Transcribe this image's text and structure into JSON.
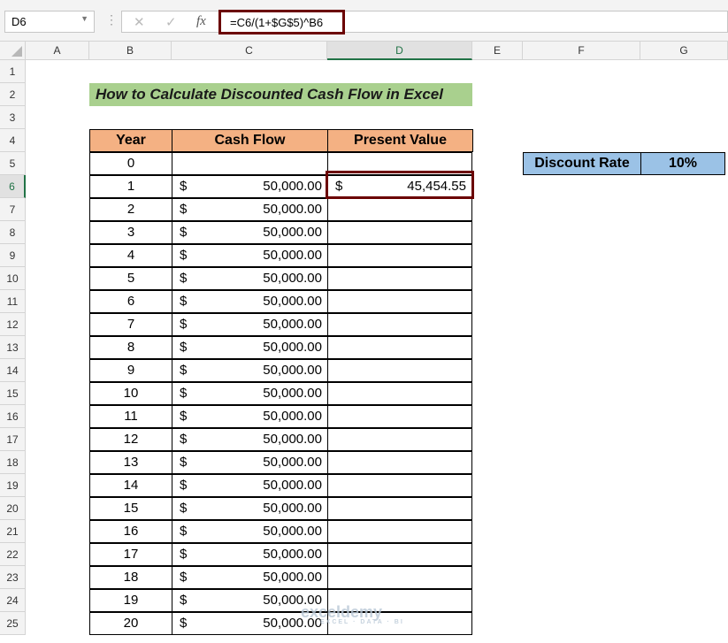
{
  "formula_bar": {
    "name_box": "D6",
    "formula": "=C6/(1+$G$5)^B6",
    "cancel_icon": "✕",
    "enter_icon": "✓",
    "fx_icon": "fx"
  },
  "columns": [
    "A",
    "B",
    "C",
    "D",
    "E",
    "F",
    "G"
  ],
  "selected_column": "D",
  "selected_row": 6,
  "title": "How to Calculate Discounted Cash Flow in Excel",
  "table": {
    "headers": [
      "Year",
      "Cash Flow",
      "Present Value"
    ],
    "rows": [
      {
        "year": "0",
        "currency": "",
        "cash_flow": "",
        "pv_currency": "",
        "pv": ""
      },
      {
        "year": "1",
        "currency": "$",
        "cash_flow": "50,000.00",
        "pv_currency": "$",
        "pv": "45,454.55"
      },
      {
        "year": "2",
        "currency": "$",
        "cash_flow": "50,000.00"
      },
      {
        "year": "3",
        "currency": "$",
        "cash_flow": "50,000.00"
      },
      {
        "year": "4",
        "currency": "$",
        "cash_flow": "50,000.00"
      },
      {
        "year": "5",
        "currency": "$",
        "cash_flow": "50,000.00"
      },
      {
        "year": "6",
        "currency": "$",
        "cash_flow": "50,000.00"
      },
      {
        "year": "7",
        "currency": "$",
        "cash_flow": "50,000.00"
      },
      {
        "year": "8",
        "currency": "$",
        "cash_flow": "50,000.00"
      },
      {
        "year": "9",
        "currency": "$",
        "cash_flow": "50,000.00"
      },
      {
        "year": "10",
        "currency": "$",
        "cash_flow": "50,000.00"
      },
      {
        "year": "11",
        "currency": "$",
        "cash_flow": "50,000.00"
      },
      {
        "year": "12",
        "currency": "$",
        "cash_flow": "50,000.00"
      },
      {
        "year": "13",
        "currency": "$",
        "cash_flow": "50,000.00"
      },
      {
        "year": "14",
        "currency": "$",
        "cash_flow": "50,000.00"
      },
      {
        "year": "15",
        "currency": "$",
        "cash_flow": "50,000.00"
      },
      {
        "year": "16",
        "currency": "$",
        "cash_flow": "50,000.00"
      },
      {
        "year": "17",
        "currency": "$",
        "cash_flow": "50,000.00"
      },
      {
        "year": "18",
        "currency": "$",
        "cash_flow": "50,000.00"
      },
      {
        "year": "19",
        "currency": "$",
        "cash_flow": "50,000.00"
      },
      {
        "year": "20",
        "currency": "$",
        "cash_flow": "50,000.00"
      }
    ]
  },
  "discount": {
    "label": "Discount Rate",
    "value": "10%"
  },
  "watermark": {
    "name": "exceldemy",
    "tagline": "EXCEL · DATA · BI"
  },
  "colors": {
    "title_fill": "#a9d08e",
    "header_fill": "#f4b183",
    "discount_fill": "#9bc2e6",
    "selection_border": "#6b0000",
    "excel_green": "#217346"
  }
}
